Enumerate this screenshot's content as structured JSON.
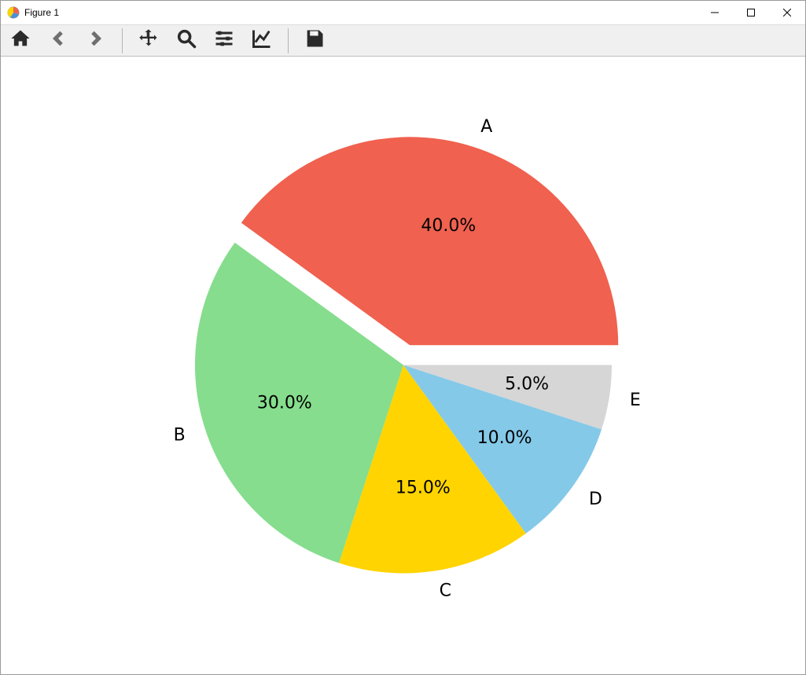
{
  "window": {
    "title": "Figure 1"
  },
  "toolbar": {
    "home": "Home",
    "back": "Back",
    "forward": "Forward",
    "pan": "Pan",
    "zoom": "Zoom",
    "configure": "Configure subplots",
    "axes": "Edit axis",
    "save": "Save"
  },
  "chart_data": {
    "type": "pie",
    "categories": [
      "A",
      "B",
      "C",
      "D",
      "E"
    ],
    "values": [
      40,
      30,
      15,
      10,
      5
    ],
    "percent_labels": [
      "40.0%",
      "30.0%",
      "15.0%",
      "10.0%",
      "5.0%"
    ],
    "colors": [
      "#f0614f",
      "#85dd8d",
      "#ffd400",
      "#85c9e8",
      "#d6d6d6"
    ],
    "explode": [
      0.1,
      0,
      0,
      0,
      0
    ],
    "startangle": 0,
    "counterclockwise": true,
    "autopct_distance": 0.6,
    "label_distance": 1.1
  }
}
